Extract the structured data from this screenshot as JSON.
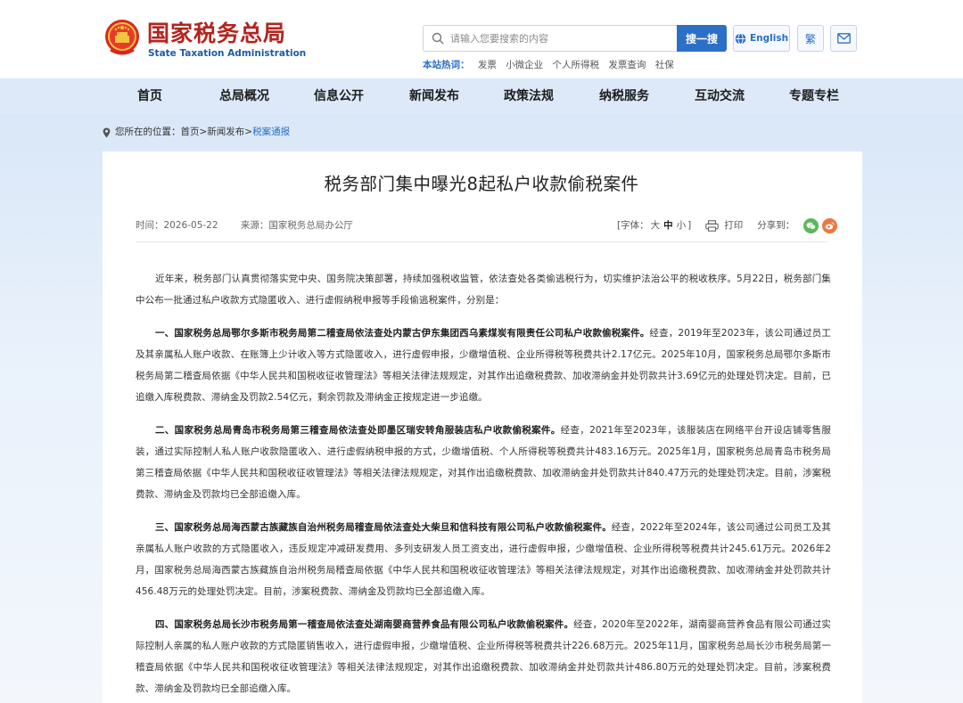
{
  "header": {
    "site_name": "国家税务总局",
    "site_name_en": "State Taxation Administration",
    "emblem_icon": "national-emblem-icon",
    "search": {
      "placeholder": "请输入您要搜索的内容",
      "button_label": "搜一搜"
    },
    "hot": {
      "label": "本站热词：",
      "items": [
        "发票",
        "小微企业",
        "个人所得税",
        "发票查询",
        "社保"
      ]
    },
    "english_label": "English",
    "traditional_label": "繁",
    "mail_icon": "mail-icon"
  },
  "nav": {
    "items": [
      "首页",
      "总局概况",
      "信息公开",
      "新闻发布",
      "政策法规",
      "纳税服务",
      "互动交流",
      "专题专栏"
    ]
  },
  "breadcrumb": {
    "prefix": "您所在的位置：",
    "path": "首页>新闻发布>",
    "current": "税案通报"
  },
  "article": {
    "title": "税务部门集中曝光8起私户收款偷税案件",
    "date": "时间：2026-05-22",
    "source": "来源：国家税务总局办公厅",
    "font_size": {
      "prefix": "[字体：",
      "large": "大",
      "medium": "中",
      "small": "小",
      "suffix": "]"
    },
    "print_label": "打印",
    "share_label": "分享到：",
    "paragraphs": [
      {
        "bold": "",
        "text": "近年来，税务部门认真贯彻落实党中央、国务院决策部署，持续加强税收监管，依法查处各类偷逃税行为，切实维护法治公平的税收秩序。5月22日，税务部门集中公布一批通过私户收款方式隐匿收入、进行虚假纳税申报等手段偷逃税案件，分别是："
      },
      {
        "bold": "一、国家税务总局鄂尔多斯市税务局第二稽查局依法查处内蒙古伊东集团西乌素煤炭有限责任公司私户收款偷税案件。",
        "text": "经查，2019年至2023年，该公司通过员工及其亲属私人账户收款、在账簿上少计收入等方式隐匿收入，进行虚假申报，少缴增值税、企业所得税等税费共计2.17亿元。2025年10月，国家税务总局鄂尔多斯市税务局第二稽查局依据《中华人民共和国税收征收管理法》等相关法律法规规定，对其作出追缴税费款、加收滞纳金并处罚款共计3.69亿元的处理处罚决定。目前，已追缴入库税费款、滞纳金及罚款2.54亿元，剩余罚款及滞纳金正按规定进一步追缴。"
      },
      {
        "bold": "二、国家税务总局青岛市税务局第三稽查局依法查处即墨区瑞安转角服装店私户收款偷税案件。",
        "text": "经查，2021年至2023年，该服装店在网络平台开设店铺零售服装，通过实际控制人私人账户收款隐匿收入、进行虚假纳税申报的方式，少缴增值税、个人所得税等税费共计483.16万元。2025年1月，国家税务总局青岛市税务局第三稽查局依据《中华人民共和国税收征收管理法》等相关法律法规规定，对其作出追缴税费款、加收滞纳金并处罚款共计840.47万元的处理处罚决定。目前，涉案税费款、滞纳金及罚款均已全部追缴入库。"
      },
      {
        "bold": "三、国家税务总局海西蒙古族藏族自治州税务局稽查局依法查处大柴旦和信科技有限公司私户收款偷税案件。",
        "text": "经查，2022年至2024年，该公司通过公司员工及其亲属私人账户收款的方式隐匿收入，违反规定冲减研发费用、多列支研发人员工资支出，进行虚假申报，少缴增值税、企业所得税等税费共计245.61万元。2026年2月，国家税务总局海西蒙古族藏族自治州税务局稽查局依据《中华人民共和国税收征收管理法》等相关法律法规规定，对其作出追缴税费款、加收滞纳金并处罚款共计456.48万元的处理处罚决定。目前，涉案税费款、滞纳金及罚款均已全部追缴入库。"
      },
      {
        "bold": "四、国家税务总局长沙市税务局第一稽查局依法查处湖南婴商营养食品有限公司私户收款偷税案件。",
        "text": "经查，2020年至2022年，湖南婴商营养食品有限公司通过实际控制人亲属的私人账户收款的方式隐匿销售收入，进行虚假申报，少缴增值税、企业所得税等税费共计226.68万元。2025年11月，国家税务总局长沙市税务局第一稽查局依据《中华人民共和国税收征收管理法》等相关法律法规规定，对其作出追缴税费款、加收滞纳金并处罚款共计486.80万元的处理处罚决定。目前，涉案税费款、滞纳金及罚款均已全部追缴入库。"
      }
    ]
  },
  "colors": {
    "brand_red": "#b3241e",
    "brand_blue": "#2b6fc7",
    "nav_bg": "#dde9f8"
  }
}
